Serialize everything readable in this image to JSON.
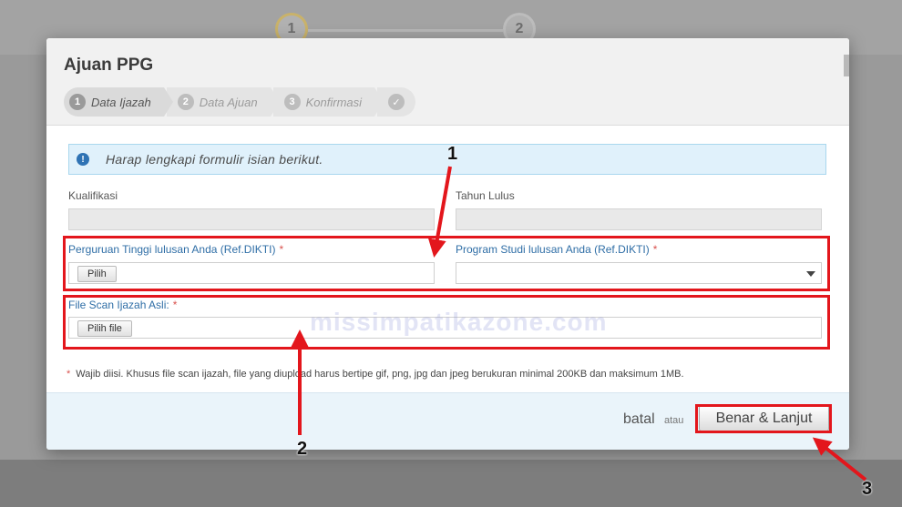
{
  "background": {
    "steps": [
      "1",
      "2"
    ]
  },
  "modal": {
    "title": "Ajuan PPG",
    "wizard": [
      {
        "num": "1",
        "label": "Data Ijazah",
        "active": true
      },
      {
        "num": "2",
        "label": "Data Ajuan",
        "active": false
      },
      {
        "num": "3",
        "label": "Konfirmasi",
        "active": false
      }
    ],
    "alert_text": "Harap lengkapi formulir isian berikut.",
    "fields": {
      "kualifikasi": {
        "label": "Kualifikasi",
        "value": ""
      },
      "tahun_lulus": {
        "label": "Tahun Lulus",
        "value": ""
      },
      "perguruan_tinggi": {
        "label": "Perguruan Tinggi lulusan Anda (Ref.DIKTI)",
        "button": "Pilih"
      },
      "program_studi": {
        "label": "Program Studi lulusan Anda (Ref.DIKTI)",
        "value": ""
      },
      "file_scan": {
        "label": "File Scan Ijazah Asli:",
        "button": "Pilih file"
      }
    },
    "required_mark": "*",
    "note": "Wajib diisi. Khusus file scan ijazah, file yang diupload harus bertipe gif, png, jpg dan jpeg berukuran minimal 200KB dan maksimum 1MB.",
    "footer": {
      "cancel": "batal",
      "or": "atau",
      "next": "Benar & Lanjut"
    }
  },
  "annotations": {
    "callouts": [
      "1",
      "2",
      "3"
    ],
    "color": "#e3161c",
    "watermark": "missimpatikazone.com"
  },
  "icons": {
    "info": "info-circle-icon",
    "done": "check-circle-icon",
    "dropdown": "chevron-down-icon"
  }
}
